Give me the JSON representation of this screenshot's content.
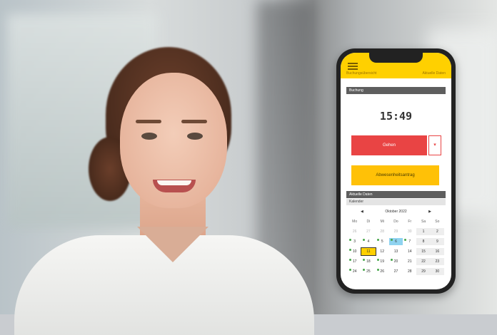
{
  "app": {
    "tabs": [
      "Buchungsübersicht",
      "Aktuelle Daten"
    ],
    "section_title": "Buchung",
    "clock": "15:49",
    "go_button": "Gehen",
    "go_dropdown": "▾",
    "yellow_button": "Abwesenheitsantrag",
    "subsection_title": "Aktuelle Daten",
    "calendar_label": "Kalender",
    "calendar": {
      "month": "Oktober 2022",
      "prev": "◀",
      "next": "▶",
      "weekdays": [
        "Mo",
        "Di",
        "Mi",
        "Do",
        "Fr",
        "Sa",
        "So"
      ],
      "days": [
        "26",
        "27",
        "28",
        "29",
        "30",
        "1",
        "2",
        "3",
        "4",
        "5",
        "6",
        "7",
        "8",
        "9",
        "10",
        "11",
        "12",
        "13",
        "14",
        "15",
        "16",
        "17",
        "18",
        "19",
        "20",
        "21",
        "22",
        "23",
        "24",
        "25",
        "26",
        "27",
        "28",
        "29",
        "30"
      ]
    }
  }
}
